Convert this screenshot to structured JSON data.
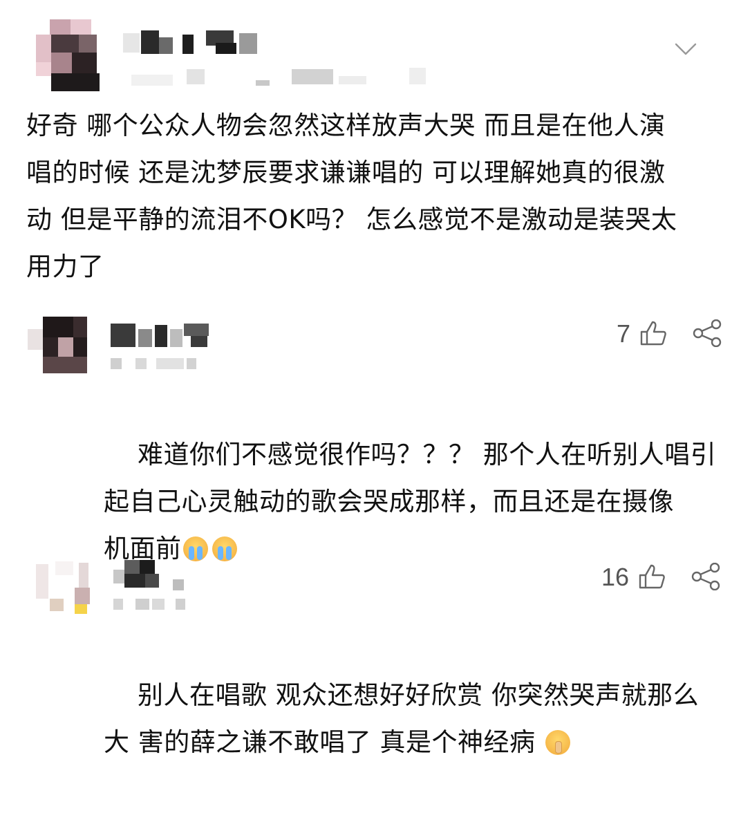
{
  "comments": [
    {
      "text": "好奇 哪个公众人物会忽然这样放声大哭 而且是在他人演\n唱的时候 还是沈梦辰要求谦谦唱的 可以理解她真的很激\n动 但是平静的流泪不OK吗？ 怎么感觉不是激动是装哭太\n用力了",
      "has_menu": true
    },
    {
      "text": "难道你们不感觉很作吗？？？ 那个人在听别人唱引\n起自己心灵触动的歌会哭成那样，而且还是在摄像\n机面前",
      "emojis": [
        "crying-face",
        "crying-face"
      ],
      "likes": "7"
    },
    {
      "text": "别人在唱歌 观众还想好好欣赏 你突然哭声就那么\n大 害的薛之谦不敢唱了 真是个神经病 ",
      "emojis": [
        "shushing-face"
      ],
      "likes": "16"
    }
  ]
}
